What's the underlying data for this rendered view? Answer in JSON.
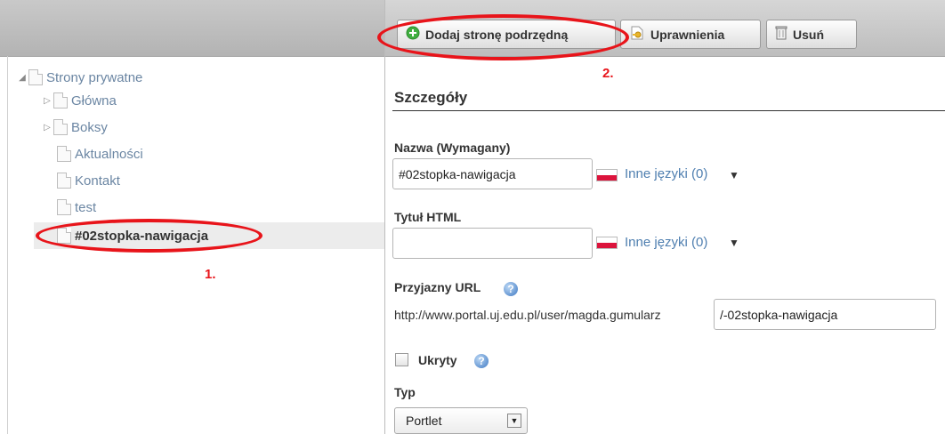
{
  "toolbar": {
    "add_subpage": "Dodaj stronę podrzędną",
    "permissions": "Uprawnienia",
    "delete": "Usuń"
  },
  "tree": {
    "root": "Strony prywatne",
    "items": [
      {
        "label": "Główna",
        "expandable": true
      },
      {
        "label": "Boksy",
        "expandable": true
      },
      {
        "label": "Aktualności",
        "expandable": false
      },
      {
        "label": "Kontakt",
        "expandable": false
      },
      {
        "label": "test",
        "expandable": false
      },
      {
        "label": "#02stopka-nawigacja",
        "expandable": false,
        "selected": true
      }
    ]
  },
  "annotations": {
    "one": "1.",
    "two": "2."
  },
  "details": {
    "title": "Szczegóły",
    "name_label": "Nazwa (Wymagany)",
    "name_value": "#02stopka-nawigacja",
    "other_langs": "Inne języki (0)",
    "html_title_label": "Tytuł HTML",
    "html_title_value": "",
    "friendly_url_label": "Przyjazny URL",
    "url_prefix": "http://www.portal.uj.edu.pl/user/magda.gumularz",
    "url_value": "/-02stopka-nawigacja",
    "hidden_label": "Ukryty",
    "hidden_checked": false,
    "type_label": "Typ",
    "type_value": "Portlet"
  },
  "colors": {
    "annotation": "#e8141a",
    "link": "#4f7fb0",
    "tree_text": "#6b86a3"
  },
  "icons": {
    "add": "plus-circle-icon",
    "permissions": "key-icon",
    "delete": "trash-icon",
    "help": "help-icon",
    "flag": "flag-pl-icon"
  }
}
